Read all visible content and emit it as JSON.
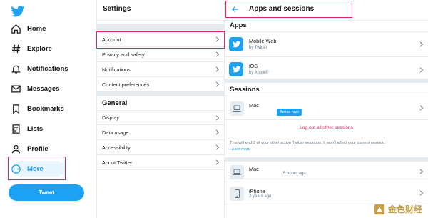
{
  "nav": {
    "items": [
      {
        "label": "Home",
        "icon": "home-icon"
      },
      {
        "label": "Explore",
        "icon": "hashtag-icon"
      },
      {
        "label": "Notifications",
        "icon": "bell-icon"
      },
      {
        "label": "Messages",
        "icon": "envelope-icon"
      },
      {
        "label": "Bookmarks",
        "icon": "bookmark-icon"
      },
      {
        "label": "Lists",
        "icon": "list-icon"
      },
      {
        "label": "Profile",
        "icon": "person-icon"
      },
      {
        "label": "More",
        "icon": "more-dots-icon"
      }
    ],
    "tweet_label": "Tweet"
  },
  "settings": {
    "title": "Settings",
    "items": [
      {
        "label": "Account"
      },
      {
        "label": "Privacy and safety"
      },
      {
        "label": "Notifications"
      },
      {
        "label": "Content preferences"
      }
    ],
    "general_title": "General",
    "general_items": [
      {
        "label": "Display"
      },
      {
        "label": "Data usage"
      },
      {
        "label": "Accessibility"
      },
      {
        "label": "About Twitter"
      }
    ]
  },
  "apps": {
    "title": "Apps and sessions",
    "apps_label": "Apps",
    "app_list": [
      {
        "name": "Mobile Web",
        "sub": "by Twitter"
      },
      {
        "name": "iOS",
        "sub": "by Apple®"
      }
    ],
    "sessions_label": "Sessions",
    "current_session": {
      "device": "Mac",
      "badge": "Active now"
    },
    "logout_label": "Log out all other sessions",
    "note": "This will end 2 of your other active Twitter sessions. It won't affect your current session.",
    "learn_more": "Learn more",
    "other_sessions": [
      {
        "device": "Mac",
        "time": "5 hours ago"
      },
      {
        "device": "iPhone",
        "time": "2 years ago"
      }
    ]
  },
  "watermark": {
    "text": "金色财经"
  },
  "colors": {
    "accent": "#1da1f2",
    "highlight_box": "#e0245e",
    "divider": "#e6ecf0"
  }
}
